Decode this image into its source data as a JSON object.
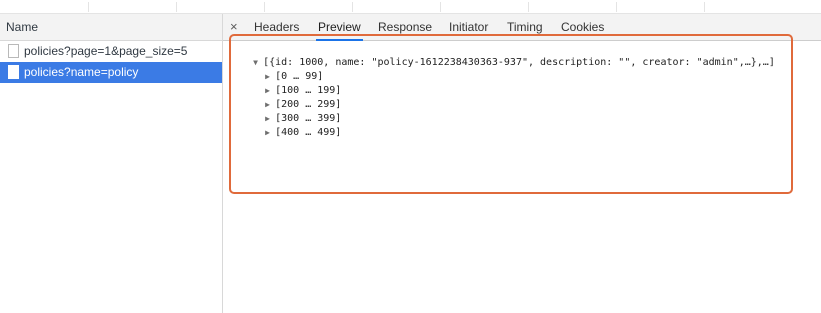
{
  "network": {
    "name_header": "Name",
    "requests": [
      {
        "label": "policies?page=1&page_size=5",
        "selected": false
      },
      {
        "label": "policies?name=policy",
        "selected": true
      }
    ]
  },
  "details": {
    "close_symbol": "×",
    "tabs": [
      "Headers",
      "Preview",
      "Response",
      "Initiator",
      "Timing",
      "Cookies"
    ],
    "active_tab": "Preview"
  },
  "preview": {
    "root_toggle": "▼",
    "root_text": "[{id: 1000, name: \"policy-1612238430363-937\", description: \"\", creator: \"admin\",…},…]",
    "group_toggle": "▶",
    "groups": [
      "[0 … 99]",
      "[100 … 199]",
      "[200 … 299]",
      "[300 … 399]",
      "[400 … 499]"
    ]
  },
  "colors": {
    "selection": "#3b7be5",
    "highlight_box": "#e06a3b",
    "active_tab_underline": "#1a73e8"
  }
}
